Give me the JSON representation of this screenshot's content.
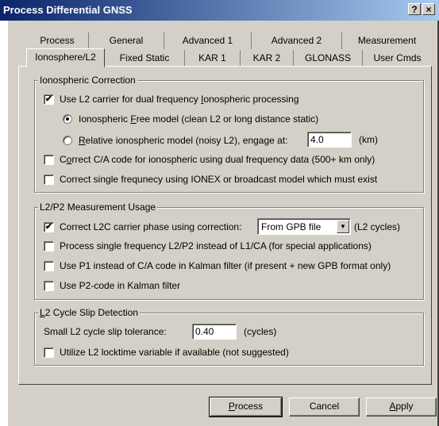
{
  "window": {
    "title": "Process Differential GNSS",
    "help_glyph": "?",
    "close_glyph": "×"
  },
  "tabs": {
    "row1": [
      "Process",
      "General",
      "Advanced 1",
      "Advanced 2",
      "Measurement"
    ],
    "row2": [
      "Ionosphere/L2",
      "Fixed Static",
      "KAR 1",
      "KAR 2",
      "GLONASS",
      "User Cmds"
    ],
    "selected": "Ionosphere/L2"
  },
  "ionospheric": {
    "legend": "Ionospheric Correction",
    "use_l2_pre": "Use L2 carrier for dual frequency ",
    "use_l2_ul": "I",
    "use_l2_post": "onospheric processing",
    "use_l2_checked": true,
    "free_pre": "Ionospheric ",
    "free_ul": "F",
    "free_post": "ree model (clean L2 or long distance static)",
    "free_selected": true,
    "relative_ul": "R",
    "relative_post": "elative ionospheric model (noisy L2), engage at:",
    "relative_selected": false,
    "engage_value": "4.0",
    "engage_unit": "(km)",
    "ca_pre": "C",
    "ca_ul": "o",
    "ca_post": "rrect C/A code for ionospheric using dual frequency data (500+ km only)",
    "ca_checked": false,
    "single_label": "Correct single frequnecy using IONEX or broadcast model which must exist",
    "single_checked": false
  },
  "l2p2": {
    "legend": "L2/P2 Measurement Usage",
    "l2c_label": "Correct L2C carrier phase using correction:",
    "l2c_checked": true,
    "l2c_option": "From GPB file",
    "l2c_unit": "(L2 cycles)",
    "single_label": "Process single frequency L2/P2 instead of L1/CA (for special applications)",
    "single_checked": false,
    "p1_label": "Use P1 instead of C/A code in Kalman filter (if present + new GPB format only)",
    "p1_checked": false,
    "p2_label": "Use P2-code in Kalman filter",
    "p2_checked": false
  },
  "slip": {
    "legend_ul": "L",
    "legend_post": "2 Cycle Slip Detection",
    "tolerance_label": "Small L2 cycle slip tolerance:",
    "tolerance_value": "0.40",
    "tolerance_unit": "(cycles)",
    "locktime_label": "Utilize L2 locktime variable if available (not suggested)",
    "locktime_checked": false
  },
  "buttons": {
    "process_ul": "P",
    "process_post": "rocess",
    "cancel": "Cancel",
    "apply_ul": "A",
    "apply_post": "pply"
  },
  "icons": {
    "checkmark": "✔",
    "dropdown": "▼"
  }
}
